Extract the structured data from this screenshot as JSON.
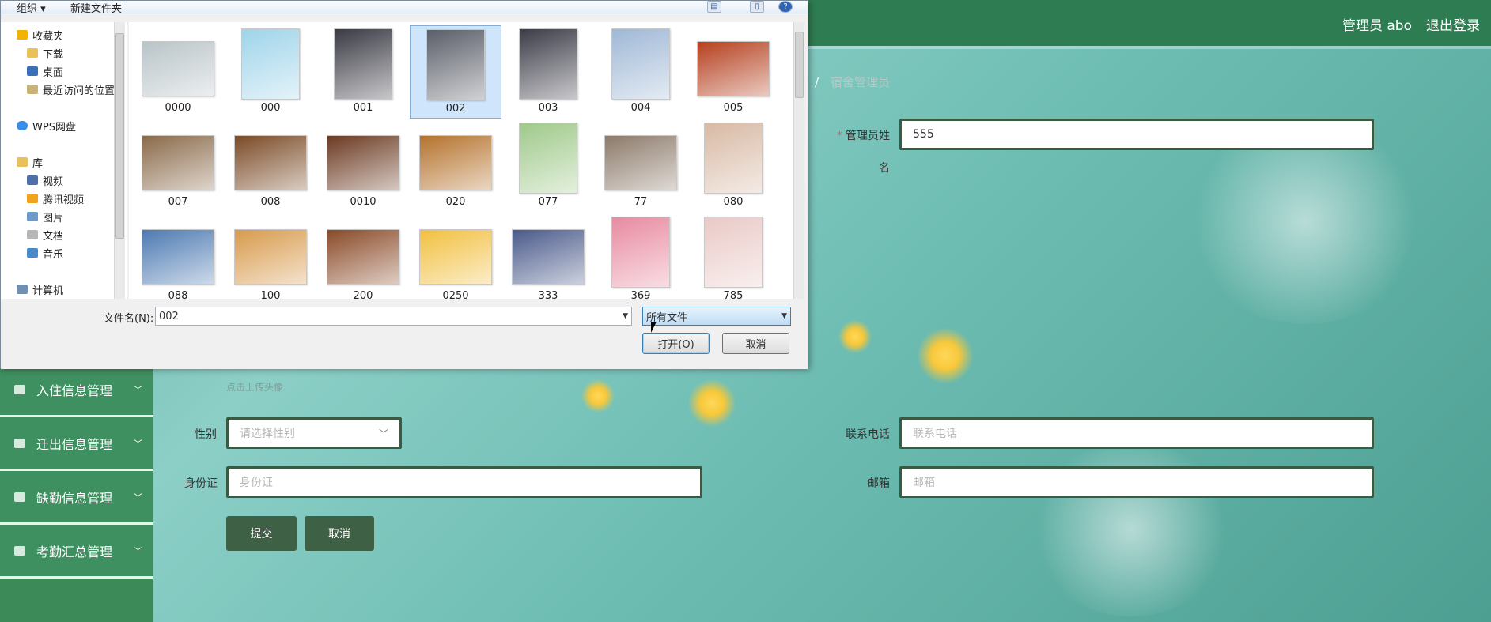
{
  "header": {
    "user": "管理员 abo",
    "logout": "退出登录"
  },
  "breadcrumb": {
    "separator": "/",
    "current": "宿舍管理员"
  },
  "sidebar": {
    "items": [
      {
        "label": "入住信息管理"
      },
      {
        "label": "迁出信息管理"
      },
      {
        "label": "缺勤信息管理"
      },
      {
        "label": "考勤汇总管理"
      }
    ]
  },
  "form": {
    "name_label_1": "管理员姓",
    "name_label_2": "名",
    "name_required": "*",
    "name_value": "555",
    "upload_hint": "点击上传头像",
    "gender_label": "性别",
    "gender_placeholder": "请选择性别",
    "phone_label": "联系电话",
    "phone_placeholder": "联系电话",
    "id_label": "身份证",
    "id_placeholder": "身份证",
    "email_label": "邮箱",
    "email_placeholder": "邮箱",
    "submit": "提交",
    "cancel": "取消"
  },
  "dialog": {
    "toolbar": {
      "organize": "组织 ▾",
      "new_folder": "新建文件夹"
    },
    "nav": [
      {
        "label": "收藏夹",
        "icon": "star-icon",
        "color": "#f2b400"
      },
      {
        "label": "下载",
        "icon": "download-folder-icon",
        "color": "#e8c15a"
      },
      {
        "label": "桌面",
        "icon": "desktop-icon",
        "color": "#3b6fb6"
      },
      {
        "label": "最近访问的位置",
        "icon": "recent-icon",
        "color": "#c9b37a"
      },
      {
        "label": "WPS网盘",
        "icon": "cloud-icon",
        "color": "#3a8ee6"
      },
      {
        "label": "库",
        "icon": "library-icon",
        "color": "#e8c15a"
      },
      {
        "label": "视频",
        "icon": "video-icon",
        "color": "#4f6fa8"
      },
      {
        "label": "腾讯视频",
        "icon": "tencent-video-icon",
        "color": "#f0a31c"
      },
      {
        "label": "图片",
        "icon": "pictures-icon",
        "color": "#6d9ac7"
      },
      {
        "label": "文档",
        "icon": "documents-icon",
        "color": "#b8b8b8"
      },
      {
        "label": "音乐",
        "icon": "music-icon",
        "color": "#4a89c9"
      },
      {
        "label": "计算机",
        "icon": "computer-icon",
        "color": "#6f8fb3"
      }
    ],
    "files": [
      {
        "name": "0000",
        "color": "#b9c4c8"
      },
      {
        "name": "000",
        "color": "#9fd4ea"
      },
      {
        "name": "001",
        "color": "#3a3a44"
      },
      {
        "name": "002",
        "color": "#5a5e68"
      },
      {
        "name": "003",
        "color": "#3c3c48"
      },
      {
        "name": "004",
        "color": "#9fb8d6"
      },
      {
        "name": "005",
        "color": "#b5401f"
      },
      {
        "name": "007",
        "color": "#8a6a4a"
      },
      {
        "name": "008",
        "color": "#7a4a26"
      },
      {
        "name": "0010",
        "color": "#6b3a22"
      },
      {
        "name": "020",
        "color": "#b5722c"
      },
      {
        "name": "077",
        "color": "#9fc98a"
      },
      {
        "name": "77",
        "color": "#8c7a6a"
      },
      {
        "name": "080",
        "color": "#d8b9a4"
      },
      {
        "name": "088",
        "color": "#4d7ab2"
      },
      {
        "name": "100",
        "color": "#d89a4c"
      },
      {
        "name": "200",
        "color": "#8a4a28"
      },
      {
        "name": "0250",
        "color": "#f2c040"
      },
      {
        "name": "333",
        "color": "#4a5a8a"
      },
      {
        "name": "369",
        "color": "#e88aa0"
      },
      {
        "name": "785",
        "color": "#e9c9c6"
      }
    ],
    "selected": "002",
    "filename_label": "文件名(N):",
    "filename_value": "002",
    "filter": "所有文件",
    "open": "打开(O)",
    "cancel": "取消"
  }
}
